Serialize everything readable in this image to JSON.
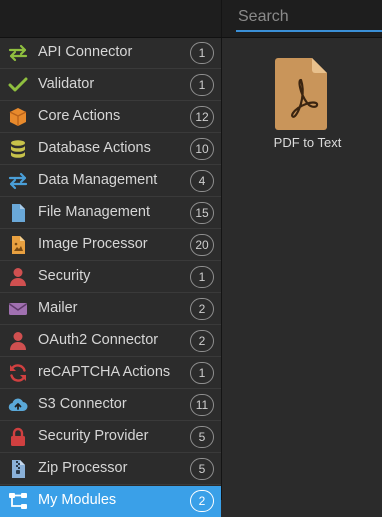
{
  "search": {
    "placeholder": "Search"
  },
  "sidebar": {
    "items": [
      {
        "label": "API Connector",
        "count": "1",
        "icon": "arrows-exchange-icon",
        "color": "#8fbf3f"
      },
      {
        "label": "Validator",
        "count": "1",
        "icon": "checkmark-icon",
        "color": "#8fbf3f"
      },
      {
        "label": "Core Actions",
        "count": "12",
        "icon": "box-icon",
        "color": "#e88a2c"
      },
      {
        "label": "Database Actions",
        "count": "10",
        "icon": "database-icon",
        "color": "#c7c24a"
      },
      {
        "label": "Data Management",
        "count": "4",
        "icon": "arrows-exchange-icon",
        "color": "#4a9fd8"
      },
      {
        "label": "File Management",
        "count": "15",
        "icon": "file-icon",
        "color": "#6aa8d8"
      },
      {
        "label": "Image Processor",
        "count": "20",
        "icon": "image-file-icon",
        "color": "#e8a040"
      },
      {
        "label": "Security",
        "count": "1",
        "icon": "user-icon",
        "color": "#d05050"
      },
      {
        "label": "Mailer",
        "count": "2",
        "icon": "envelope-icon",
        "color": "#a070b0"
      },
      {
        "label": "OAuth2 Connector",
        "count": "2",
        "icon": "user-icon",
        "color": "#d05050"
      },
      {
        "label": "reCAPTCHA Actions",
        "count": "1",
        "icon": "refresh-icon",
        "color": "#d04040"
      },
      {
        "label": "S3 Connector",
        "count": "11",
        "icon": "cloud-upload-icon",
        "color": "#5aa8d8"
      },
      {
        "label": "Security Provider",
        "count": "5",
        "icon": "lock-icon",
        "color": "#d04040"
      },
      {
        "label": "Zip Processor",
        "count": "5",
        "icon": "zip-file-icon",
        "color": "#8ab0d8"
      },
      {
        "label": "My Modules",
        "count": "2",
        "icon": "sitemap-icon",
        "color": "#ffffff",
        "active": true
      }
    ]
  },
  "main": {
    "tiles": [
      {
        "label": "PDF to Text",
        "icon": "pdf-file-icon",
        "color": "#c9955a"
      }
    ]
  }
}
